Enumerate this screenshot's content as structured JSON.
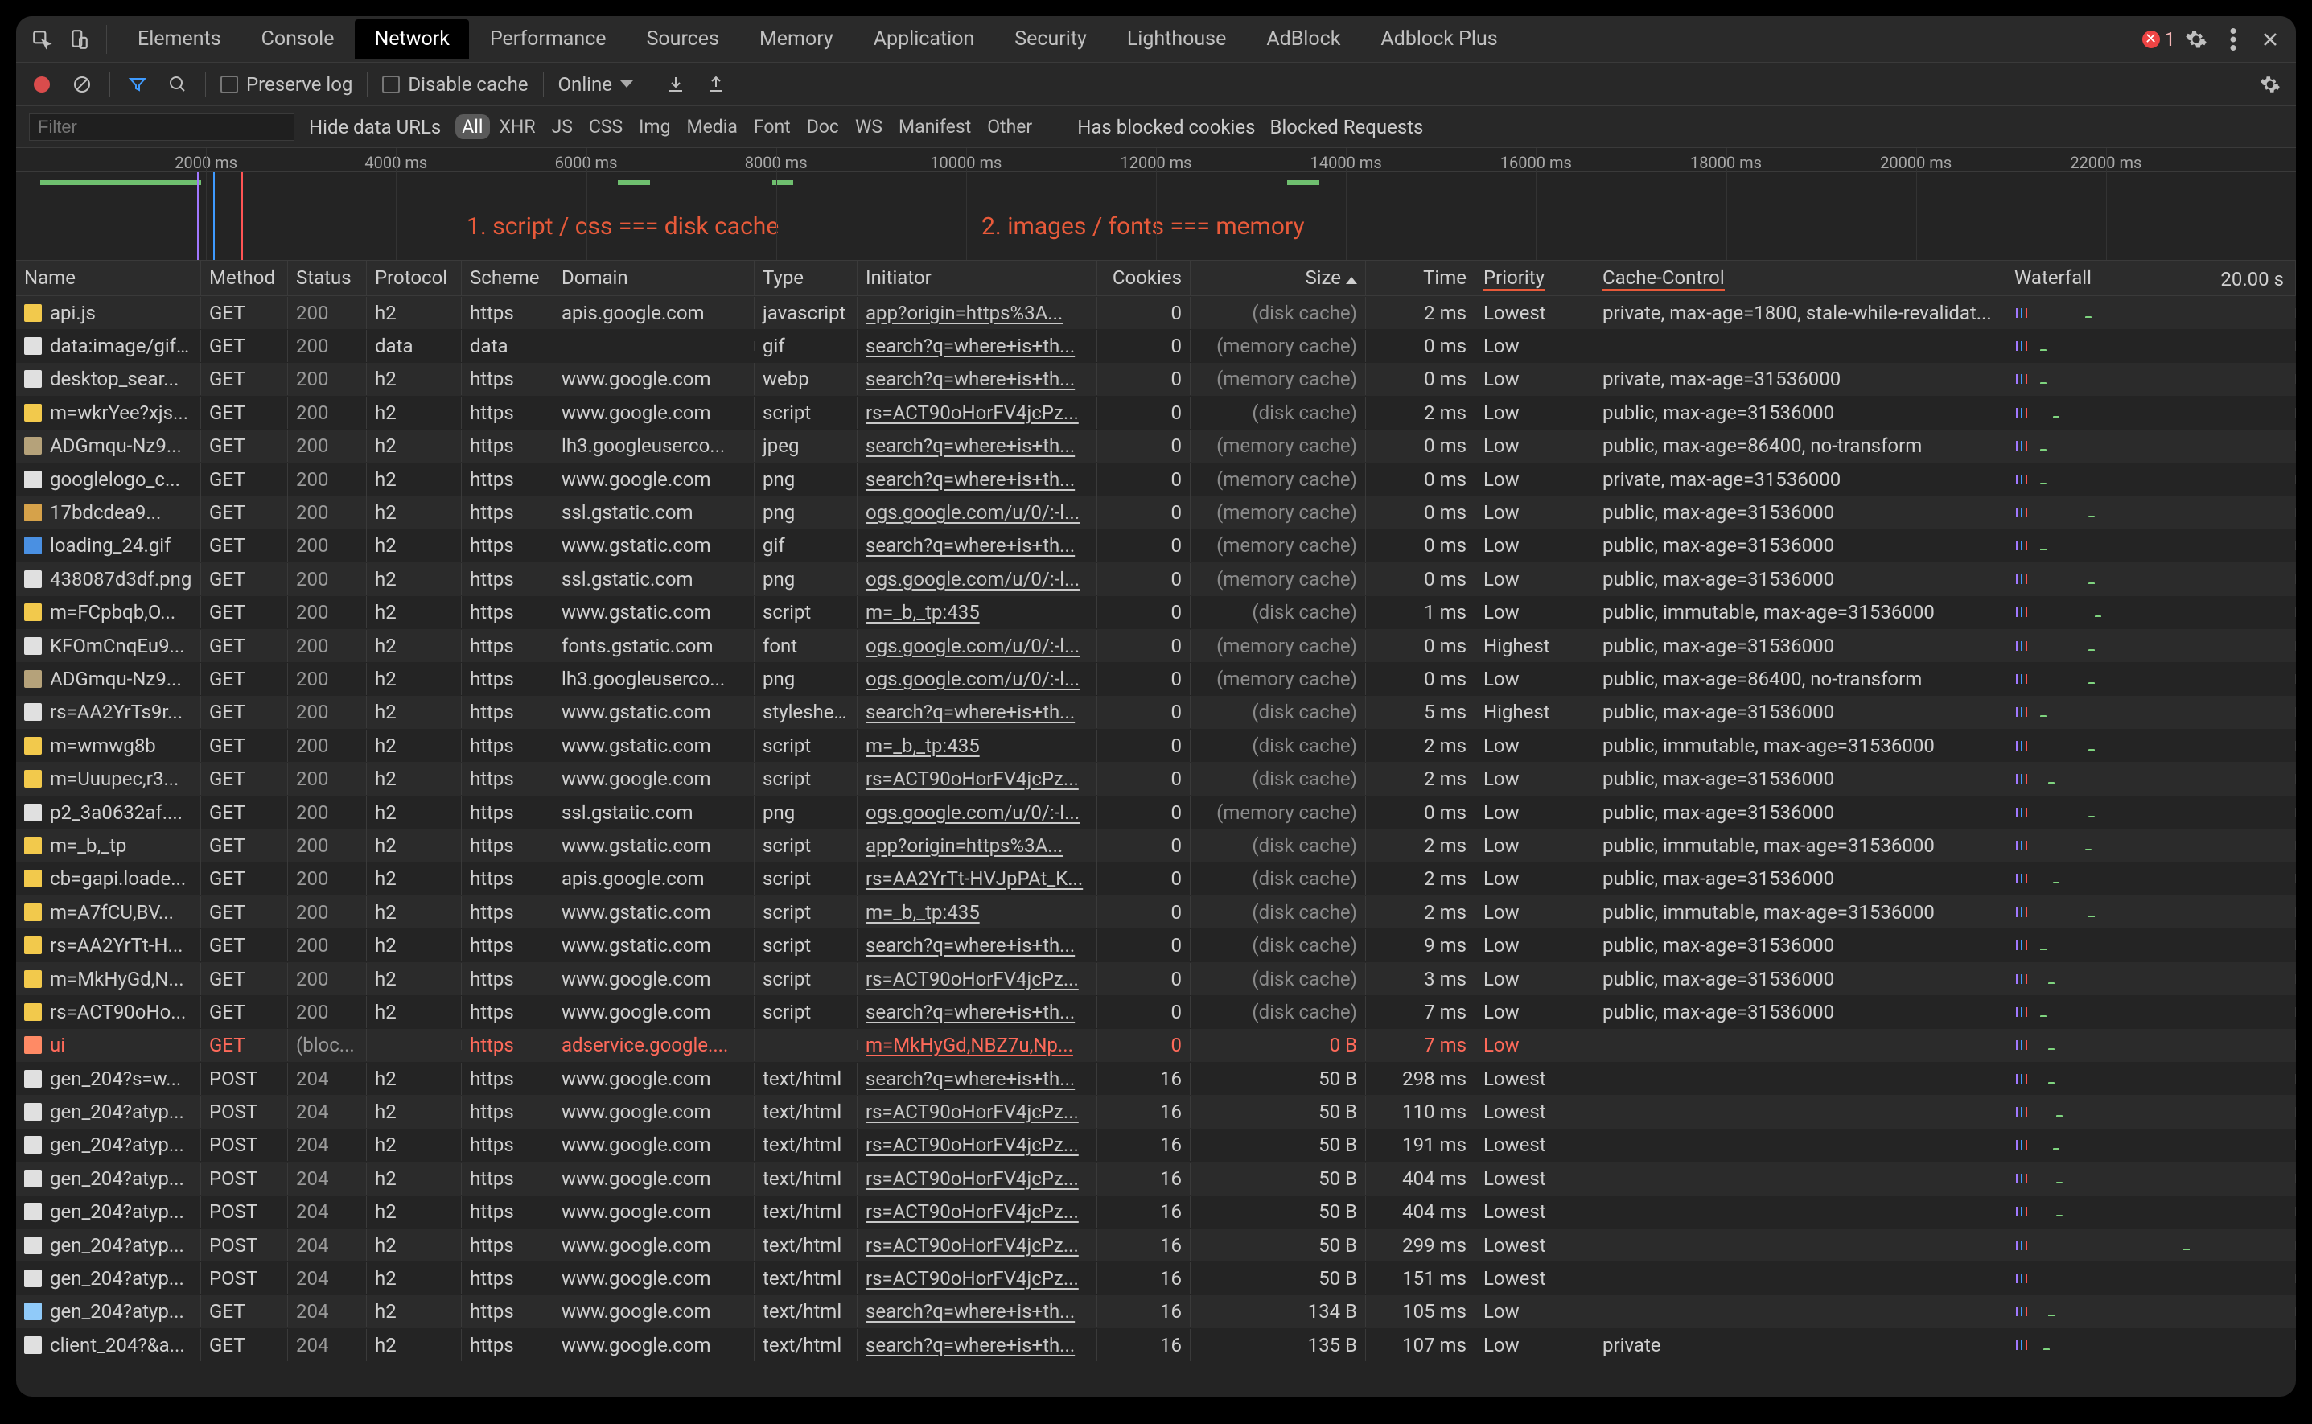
{
  "tabs": [
    "Elements",
    "Console",
    "Network",
    "Performance",
    "Sources",
    "Memory",
    "Application",
    "Security",
    "Lighthouse",
    "AdBlock",
    "Adblock Plus"
  ],
  "active_tab": "Network",
  "error_count": "1",
  "toolbar": {
    "preserve_log": "Preserve log",
    "disable_cache": "Disable cache",
    "throttle": "Online"
  },
  "filters": {
    "placeholder": "Filter",
    "hide_data_urls": "Hide data URLs",
    "chips": [
      "All",
      "XHR",
      "JS",
      "CSS",
      "Img",
      "Media",
      "Font",
      "Doc",
      "WS",
      "Manifest",
      "Other"
    ],
    "active_chip": "All",
    "has_blocked_cookies": "Has blocked cookies",
    "blocked_requests": "Blocked Requests"
  },
  "timeline": {
    "ticks": [
      "2000 ms",
      "4000 ms",
      "6000 ms",
      "8000 ms",
      "10000 ms",
      "12000 ms",
      "14000 ms",
      "16000 ms",
      "18000 ms",
      "20000 ms",
      "22000 ms"
    ],
    "anno1": "1.  script / css === disk cache",
    "anno2": "2. images / fonts === memory"
  },
  "columns": {
    "name": "Name",
    "method": "Method",
    "status": "Status",
    "protocol": "Protocol",
    "scheme": "Scheme",
    "domain": "Domain",
    "type": "Type",
    "initiator": "Initiator",
    "cookies": "Cookies",
    "size": "Size",
    "time": "Time",
    "priority": "Priority",
    "cache": "Cache-Control",
    "waterfall": "Waterfall",
    "waterfall_time": "20.00 s"
  },
  "rows": [
    {
      "name": "api.js",
      "method": "GET",
      "status": "200",
      "protocol": "h2",
      "scheme": "https",
      "domain": "apis.google.com",
      "type": "javascript",
      "initiator": "app?origin=https%3A...",
      "cookies": "0",
      "size": "(disk cache)",
      "time": "2 ms",
      "priority": "Lowest",
      "cache": "private, max-age=1800, stale-while-revalidat...",
      "icon": "#f2c94c",
      "wf": 68
    },
    {
      "name": "data:image/gif;...",
      "method": "GET",
      "status": "200",
      "protocol": "data",
      "scheme": "data",
      "domain": "",
      "type": "gif",
      "initiator": "search?q=where+is+th...",
      "cookies": "0",
      "size": "(memory cache)",
      "time": "0 ms",
      "priority": "Low",
      "cache": "",
      "icon": "#e0e0e0",
      "wf": 12
    },
    {
      "name": "desktop_sear...",
      "method": "GET",
      "status": "200",
      "protocol": "h2",
      "scheme": "https",
      "domain": "www.google.com",
      "type": "webp",
      "initiator": "search?q=where+is+th...",
      "cookies": "0",
      "size": "(memory cache)",
      "time": "0 ms",
      "priority": "Low",
      "cache": "private, max-age=31536000",
      "icon": "#e0e0e0",
      "wf": 12
    },
    {
      "name": "m=wkrYee?xjs...",
      "method": "GET",
      "status": "200",
      "protocol": "h2",
      "scheme": "https",
      "domain": "www.google.com",
      "type": "script",
      "initiator": "rs=ACT90oHorFV4jcPz...",
      "cookies": "0",
      "size": "(disk cache)",
      "time": "2 ms",
      "priority": "Low",
      "cache": "public, max-age=31536000",
      "icon": "#f2c94c",
      "wf": 28
    },
    {
      "name": "ADGmqu-Nz9...",
      "method": "GET",
      "status": "200",
      "protocol": "h2",
      "scheme": "https",
      "domain": "lh3.googleuserco...",
      "type": "jpeg",
      "initiator": "search?q=where+is+th...",
      "cookies": "0",
      "size": "(memory cache)",
      "time": "0 ms",
      "priority": "Low",
      "cache": "public, max-age=86400, no-transform",
      "icon": "#b5a27a",
      "wf": 12
    },
    {
      "name": "googlelogo_c...",
      "method": "GET",
      "status": "200",
      "protocol": "h2",
      "scheme": "https",
      "domain": "www.google.com",
      "type": "png",
      "initiator": "search?q=where+is+th...",
      "cookies": "0",
      "size": "(memory cache)",
      "time": "0 ms",
      "priority": "Low",
      "cache": "private, max-age=31536000",
      "icon": "#e0e0e0",
      "wf": 12
    },
    {
      "name": "17bdcdea9...",
      "method": "GET",
      "status": "200",
      "protocol": "h2",
      "scheme": "https",
      "domain": "ssl.gstatic.com",
      "type": "png",
      "initiator": "ogs.google.com/u/0/:-l...",
      "cookies": "0",
      "size": "(memory cache)",
      "time": "0 ms",
      "priority": "Low",
      "cache": "public, max-age=31536000",
      "icon": "#d6a24a",
      "wf": 72
    },
    {
      "name": "loading_24.gif",
      "method": "GET",
      "status": "200",
      "protocol": "h2",
      "scheme": "https",
      "domain": "www.gstatic.com",
      "type": "gif",
      "initiator": "search?q=where+is+th...",
      "cookies": "0",
      "size": "(memory cache)",
      "time": "0 ms",
      "priority": "Low",
      "cache": "public, max-age=31536000",
      "icon": "#4a90e2",
      "wf": 12
    },
    {
      "name": "438087d3df.png",
      "method": "GET",
      "status": "200",
      "protocol": "h2",
      "scheme": "https",
      "domain": "ssl.gstatic.com",
      "type": "png",
      "initiator": "ogs.google.com/u/0/:-l...",
      "cookies": "0",
      "size": "(memory cache)",
      "time": "0 ms",
      "priority": "Low",
      "cache": "public, max-age=31536000",
      "icon": "#e0e0e0",
      "wf": 72
    },
    {
      "name": "m=FCpbqb,O...",
      "method": "GET",
      "status": "200",
      "protocol": "h2",
      "scheme": "https",
      "domain": "www.gstatic.com",
      "type": "script",
      "initiator": "m=_b,_tp:435",
      "cookies": "0",
      "size": "(disk cache)",
      "time": "1 ms",
      "priority": "Low",
      "cache": "public, immutable, max-age=31536000",
      "icon": "#f2c94c",
      "wf": 80
    },
    {
      "name": "KFOmCnqEu9...",
      "method": "GET",
      "status": "200",
      "protocol": "h2",
      "scheme": "https",
      "domain": "fonts.gstatic.com",
      "type": "font",
      "initiator": "ogs.google.com/u/0/:-l...",
      "cookies": "0",
      "size": "(memory cache)",
      "time": "0 ms",
      "priority": "Highest",
      "cache": "public, max-age=31536000",
      "icon": "#e0e0e0",
      "wf": 72
    },
    {
      "name": "ADGmqu-Nz9...",
      "method": "GET",
      "status": "200",
      "protocol": "h2",
      "scheme": "https",
      "domain": "lh3.googleuserco...",
      "type": "png",
      "initiator": "ogs.google.com/u/0/:-l...",
      "cookies": "0",
      "size": "(memory cache)",
      "time": "0 ms",
      "priority": "Low",
      "cache": "public, max-age=86400, no-transform",
      "icon": "#b5a27a",
      "wf": 72
    },
    {
      "name": "rs=AA2YrTs9r...",
      "method": "GET",
      "status": "200",
      "protocol": "h2",
      "scheme": "https",
      "domain": "www.gstatic.com",
      "type": "stylesheet",
      "initiator": "search?q=where+is+th...",
      "cookies": "0",
      "size": "(disk cache)",
      "time": "5 ms",
      "priority": "Highest",
      "cache": "public, max-age=31536000",
      "icon": "#e0e0e0",
      "wf": 12
    },
    {
      "name": "m=wmwg8b",
      "method": "GET",
      "status": "200",
      "protocol": "h2",
      "scheme": "https",
      "domain": "www.gstatic.com",
      "type": "script",
      "initiator": "m=_b,_tp:435",
      "cookies": "0",
      "size": "(disk cache)",
      "time": "2 ms",
      "priority": "Low",
      "cache": "public, immutable, max-age=31536000",
      "icon": "#f2c94c",
      "wf": 72
    },
    {
      "name": "m=Uuupec,r3...",
      "method": "GET",
      "status": "200",
      "protocol": "h2",
      "scheme": "https",
      "domain": "www.google.com",
      "type": "script",
      "initiator": "rs=ACT90oHorFV4jcPz...",
      "cookies": "0",
      "size": "(disk cache)",
      "time": "2 ms",
      "priority": "Low",
      "cache": "public, max-age=31536000",
      "icon": "#f2c94c",
      "wf": 22
    },
    {
      "name": "p2_3a0632af....",
      "method": "GET",
      "status": "200",
      "protocol": "h2",
      "scheme": "https",
      "domain": "ssl.gstatic.com",
      "type": "png",
      "initiator": "ogs.google.com/u/0/:-l...",
      "cookies": "0",
      "size": "(memory cache)",
      "time": "0 ms",
      "priority": "Low",
      "cache": "public, max-age=31536000",
      "icon": "#e0e0e0",
      "wf": 72
    },
    {
      "name": "m=_b,_tp",
      "method": "GET",
      "status": "200",
      "protocol": "h2",
      "scheme": "https",
      "domain": "www.gstatic.com",
      "type": "script",
      "initiator": "app?origin=https%3A...",
      "cookies": "0",
      "size": "(disk cache)",
      "time": "2 ms",
      "priority": "Low",
      "cache": "public, immutable, max-age=31536000",
      "icon": "#f2c94c",
      "wf": 68
    },
    {
      "name": "cb=gapi.loade...",
      "method": "GET",
      "status": "200",
      "protocol": "h2",
      "scheme": "https",
      "domain": "apis.google.com",
      "type": "script",
      "initiator": "rs=AA2YrTt-HVJpPAt_K...",
      "cookies": "0",
      "size": "(disk cache)",
      "time": "2 ms",
      "priority": "Low",
      "cache": "public, max-age=31536000",
      "icon": "#f2c94c",
      "wf": 28
    },
    {
      "name": "m=A7fCU,BV...",
      "method": "GET",
      "status": "200",
      "protocol": "h2",
      "scheme": "https",
      "domain": "www.gstatic.com",
      "type": "script",
      "initiator": "m=_b,_tp:435",
      "cookies": "0",
      "size": "(disk cache)",
      "time": "2 ms",
      "priority": "Low",
      "cache": "public, immutable, max-age=31536000",
      "icon": "#f2c94c",
      "wf": 72
    },
    {
      "name": "rs=AA2YrTt-H...",
      "method": "GET",
      "status": "200",
      "protocol": "h2",
      "scheme": "https",
      "domain": "www.gstatic.com",
      "type": "script",
      "initiator": "search?q=where+is+th...",
      "cookies": "0",
      "size": "(disk cache)",
      "time": "9 ms",
      "priority": "Low",
      "cache": "public, max-age=31536000",
      "icon": "#f2c94c",
      "wf": 12
    },
    {
      "name": "m=MkHyGd,N...",
      "method": "GET",
      "status": "200",
      "protocol": "h2",
      "scheme": "https",
      "domain": "www.google.com",
      "type": "script",
      "initiator": "rs=ACT90oHorFV4jcPz...",
      "cookies": "0",
      "size": "(disk cache)",
      "time": "3 ms",
      "priority": "Low",
      "cache": "public, max-age=31536000",
      "icon": "#f2c94c",
      "wf": 22
    },
    {
      "name": "rs=ACT90oHo...",
      "method": "GET",
      "status": "200",
      "protocol": "h2",
      "scheme": "https",
      "domain": "www.google.com",
      "type": "script",
      "initiator": "search?q=where+is+th...",
      "cookies": "0",
      "size": "(disk cache)",
      "time": "7 ms",
      "priority": "Low",
      "cache": "public, max-age=31536000",
      "icon": "#f2c94c",
      "wf": 12
    },
    {
      "name": "ui",
      "method": "GET",
      "status": "(bloc...",
      "protocol": "",
      "scheme": "https",
      "domain": "adservice.google....",
      "type": "",
      "initiator": "m=MkHyGd,NBZ7u,Np...",
      "cookies": "0",
      "size": "0 B",
      "time": "7 ms",
      "priority": "Low",
      "cache": "",
      "icon": "#ff8a65",
      "blocked": true,
      "wf": 22
    },
    {
      "name": "gen_204?s=w...",
      "method": "POST",
      "status": "204",
      "protocol": "h2",
      "scheme": "https",
      "domain": "www.google.com",
      "type": "text/html",
      "initiator": "search?q=where+is+th...",
      "cookies": "16",
      "size": "50 B",
      "time": "298 ms",
      "priority": "Lowest",
      "cache": "",
      "icon": "#e0e0e0",
      "wf": 22
    },
    {
      "name": "gen_204?atyp...",
      "method": "POST",
      "status": "204",
      "protocol": "h2",
      "scheme": "https",
      "domain": "www.google.com",
      "type": "text/html",
      "initiator": "rs=ACT90oHorFV4jcPz...",
      "cookies": "16",
      "size": "50 B",
      "time": "110 ms",
      "priority": "Lowest",
      "cache": "",
      "icon": "#e0e0e0",
      "wf": 32
    },
    {
      "name": "gen_204?atyp...",
      "method": "POST",
      "status": "204",
      "protocol": "h2",
      "scheme": "https",
      "domain": "www.google.com",
      "type": "text/html",
      "initiator": "rs=ACT90oHorFV4jcPz...",
      "cookies": "16",
      "size": "50 B",
      "time": "191 ms",
      "priority": "Lowest",
      "cache": "",
      "icon": "#e0e0e0",
      "wf": 28
    },
    {
      "name": "gen_204?atyp...",
      "method": "POST",
      "status": "204",
      "protocol": "h2",
      "scheme": "https",
      "domain": "www.google.com",
      "type": "text/html",
      "initiator": "rs=ACT90oHorFV4jcPz...",
      "cookies": "16",
      "size": "50 B",
      "time": "404 ms",
      "priority": "Lowest",
      "cache": "",
      "icon": "#e0e0e0",
      "wf": 32
    },
    {
      "name": "gen_204?atyp...",
      "method": "POST",
      "status": "204",
      "protocol": "h2",
      "scheme": "https",
      "domain": "www.google.com",
      "type": "text/html",
      "initiator": "rs=ACT90oHorFV4jcPz...",
      "cookies": "16",
      "size": "50 B",
      "time": "404 ms",
      "priority": "Lowest",
      "cache": "",
      "icon": "#e0e0e0",
      "wf": 32
    },
    {
      "name": "gen_204?atyp...",
      "method": "POST",
      "status": "204",
      "protocol": "h2",
      "scheme": "https",
      "domain": "www.google.com",
      "type": "text/html",
      "initiator": "rs=ACT90oHorFV4jcPz...",
      "cookies": "16",
      "size": "50 B",
      "time": "299 ms",
      "priority": "Lowest",
      "cache": "",
      "icon": "#e0e0e0",
      "wf": 190
    },
    {
      "name": "gen_204?atyp...",
      "method": "POST",
      "status": "204",
      "protocol": "h2",
      "scheme": "https",
      "domain": "www.google.com",
      "type": "text/html",
      "initiator": "rs=ACT90oHorFV4jcPz...",
      "cookies": "16",
      "size": "50 B",
      "time": "151 ms",
      "priority": "Lowest",
      "cache": "",
      "icon": "#e0e0e0",
      "wf": 330
    },
    {
      "name": "gen_204?atyp...",
      "method": "GET",
      "status": "204",
      "protocol": "h2",
      "scheme": "https",
      "domain": "www.google.com",
      "type": "text/html",
      "initiator": "search?q=where+is+th...",
      "cookies": "16",
      "size": "134 B",
      "time": "105 ms",
      "priority": "Low",
      "cache": "",
      "icon": "#90caf9",
      "wf": 22
    },
    {
      "name": "client_204?&a...",
      "method": "GET",
      "status": "204",
      "protocol": "h2",
      "scheme": "https",
      "domain": "www.google.com",
      "type": "text/html",
      "initiator": "search?q=where+is+th...",
      "cookies": "16",
      "size": "135 B",
      "time": "107 ms",
      "priority": "Low",
      "cache": "private",
      "icon": "#e0e0e0",
      "wf": 16
    }
  ]
}
